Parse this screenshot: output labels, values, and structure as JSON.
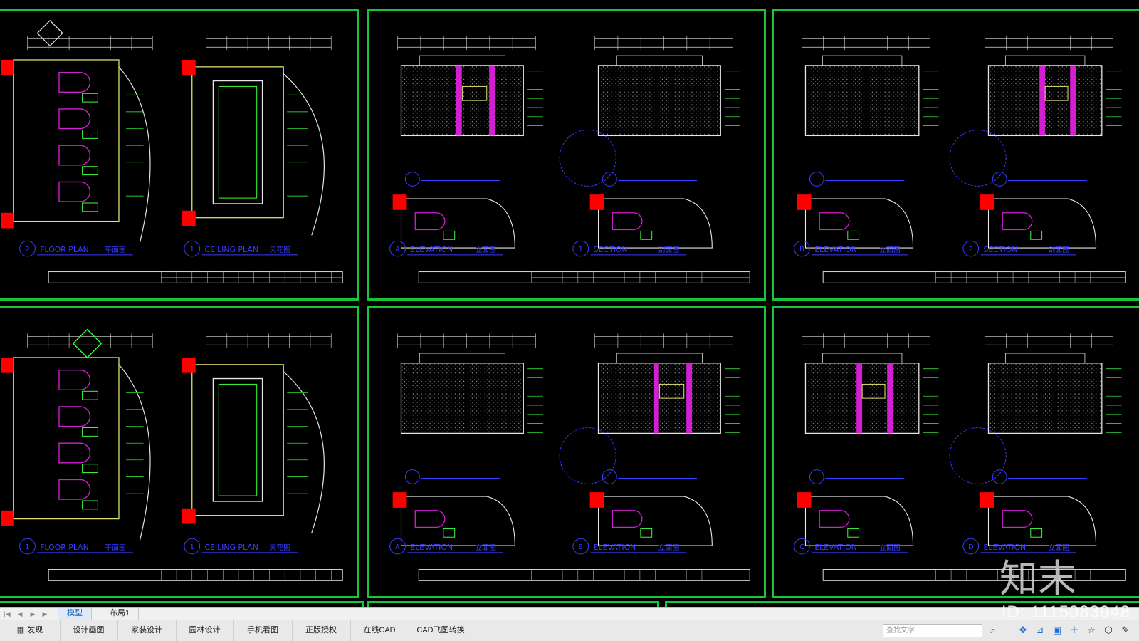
{
  "sheets": [
    {
      "left_label": "FLOOR PLAN",
      "left_sub": "平面图",
      "left_num": "2",
      "right_label": "CEILING PLAN",
      "right_sub": "天花图",
      "right_num": "1"
    },
    {
      "left_label": "ELEVATION",
      "left_sub": "立面图",
      "left_num": "A",
      "right_label": "SECTION",
      "right_sub": "剖面图",
      "right_num": "1"
    },
    {
      "left_label": "ELEVATION",
      "left_sub": "立面图",
      "left_num": "B",
      "right_label": "SECTION",
      "right_sub": "剖面图",
      "right_num": "2"
    },
    {
      "left_label": "FLOOR PLAN",
      "left_sub": "平面图",
      "left_num": "1",
      "right_label": "CEILING PLAN",
      "right_sub": "天花图",
      "right_num": "1"
    },
    {
      "left_label": "ELEVATION",
      "left_sub": "立面图",
      "left_num": "A",
      "right_label": "ELEVATION",
      "right_sub": "立面图",
      "right_num": "B"
    },
    {
      "left_label": "ELEVATION",
      "left_sub": "立面图",
      "left_num": "C",
      "right_label": "ELEVATION",
      "right_sub": "立面图",
      "right_num": "D"
    }
  ],
  "layout_tabs": {
    "model": "模型",
    "layout1": "布局1"
  },
  "toolbar": {
    "discover": "发现",
    "buttons": [
      "设计画图",
      "家装设计",
      "园林设计",
      "手机看图",
      "正版授权",
      "在线CAD",
      "CAD飞图转换"
    ]
  },
  "search": {
    "placeholder": "查找文字"
  },
  "watermark": {
    "logo": "知末",
    "id": "ID: 1115083948"
  },
  "colors": {
    "frame": "#17c53a",
    "line": "#3cff3c",
    "blue": "#3a3cff",
    "magenta": "#d21fd2",
    "red": "#ff0000",
    "yellow": "#e0e070"
  }
}
